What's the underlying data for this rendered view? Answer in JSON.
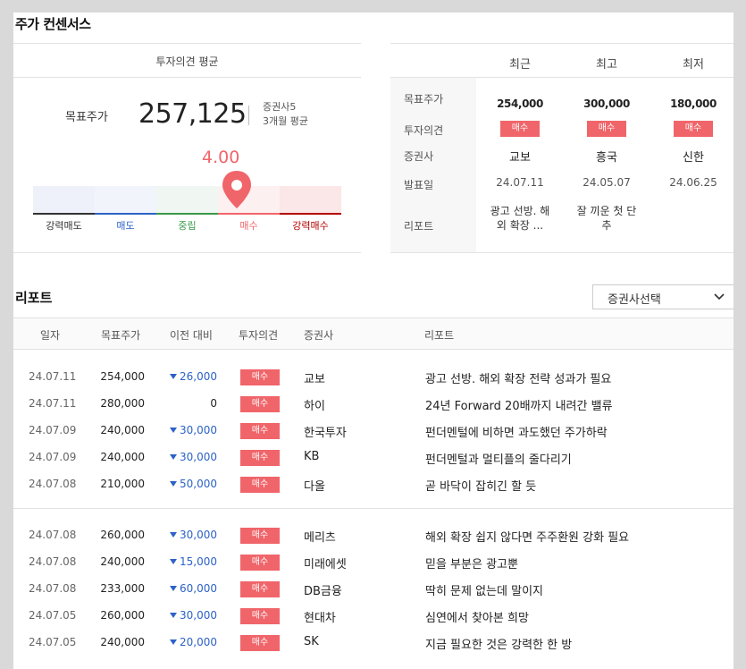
{
  "header": {
    "title": "주가 컨센서스"
  },
  "consensus": {
    "section_label": "투자의견 평균",
    "target_label": "목표주가",
    "target_value": "257,125",
    "broker_count": "증권사5",
    "period": "3개월 평균",
    "score_text": "4.00",
    "score": 4.0,
    "scale": [
      {
        "label": "강력매도",
        "color": "#333333",
        "bg": "#eef1fa"
      },
      {
        "label": "매도",
        "color": "#2d62c6",
        "bg": "#f1f4fb"
      },
      {
        "label": "중립",
        "color": "#3a9a4a",
        "bg": "#f0f6f1"
      },
      {
        "label": "매수",
        "color": "#f0656a",
        "bg": "#fdf0f0"
      },
      {
        "label": "강력매수",
        "color": "#b30000",
        "bg": "#fbe7e7"
      }
    ]
  },
  "summary": {
    "col_headers": [
      "최근",
      "최고",
      "최저"
    ],
    "row_labels": [
      "목표주가",
      "투자의견",
      "증권사",
      "발표일",
      "리포트"
    ],
    "columns": [
      {
        "price": "254,000",
        "opinion": "매수",
        "broker": "교보",
        "date": "24.07.11",
        "report_line1": "광고 선방. 해",
        "report_line2": "외 확장 ..."
      },
      {
        "price": "300,000",
        "opinion": "매수",
        "broker": "흥국",
        "date": "24.05.07",
        "report_line1": "잘 끼운 첫 단",
        "report_line2": "추"
      },
      {
        "price": "180,000",
        "opinion": "매수",
        "broker": "신한",
        "date": "24.06.25",
        "report_line1": "",
        "report_line2": ""
      }
    ]
  },
  "reports": {
    "title": "리포트",
    "select_label": "증권사선택",
    "headers": [
      "일자",
      "목표주가",
      "이전 대비",
      "투자의견",
      "증권사",
      "리포트"
    ],
    "rows": [
      {
        "date": "24.07.11",
        "price": "254,000",
        "change": "26,000",
        "dir": "down",
        "opinion": "매수",
        "broker": "교보",
        "title": "광고 선방. 해외 확장 전략 성과가 필요"
      },
      {
        "date": "24.07.11",
        "price": "280,000",
        "change": "0",
        "dir": "none",
        "opinion": "매수",
        "broker": "하이",
        "title": "24년 Forward 20배까지 내려간 밸류"
      },
      {
        "date": "24.07.09",
        "price": "240,000",
        "change": "30,000",
        "dir": "down",
        "opinion": "매수",
        "broker": "한국투자",
        "title": "펀더멘털에 비하면 과도했던 주가하락"
      },
      {
        "date": "24.07.09",
        "price": "240,000",
        "change": "30,000",
        "dir": "down",
        "opinion": "매수",
        "broker": "KB",
        "title": "펀더멘털과 멀티플의 줄다리기"
      },
      {
        "date": "24.07.08",
        "price": "210,000",
        "change": "50,000",
        "dir": "down",
        "opinion": "매수",
        "broker": "다올",
        "title": "곧 바닥이 잡히긴 할 듯"
      },
      {
        "date": "24.07.08",
        "price": "260,000",
        "change": "30,000",
        "dir": "down",
        "opinion": "매수",
        "broker": "메리츠",
        "title": "해외 확장 쉽지 않다면 주주환원 강화 필요"
      },
      {
        "date": "24.07.08",
        "price": "240,000",
        "change": "15,000",
        "dir": "down",
        "opinion": "매수",
        "broker": "미래에셋",
        "title": "믿을 부분은 광고뿐"
      },
      {
        "date": "24.07.08",
        "price": "233,000",
        "change": "60,000",
        "dir": "down",
        "opinion": "매수",
        "broker": "DB금융",
        "title": "딱히 문제 없는데 말이지"
      },
      {
        "date": "24.07.05",
        "price": "260,000",
        "change": "30,000",
        "dir": "down",
        "opinion": "매수",
        "broker": "현대차",
        "title": "심연에서 찾아본 희망"
      },
      {
        "date": "24.07.05",
        "price": "240,000",
        "change": "20,000",
        "dir": "down",
        "opinion": "매수",
        "broker": "SK",
        "title": "지금 필요한 것은 강력한 한 방"
      }
    ]
  }
}
